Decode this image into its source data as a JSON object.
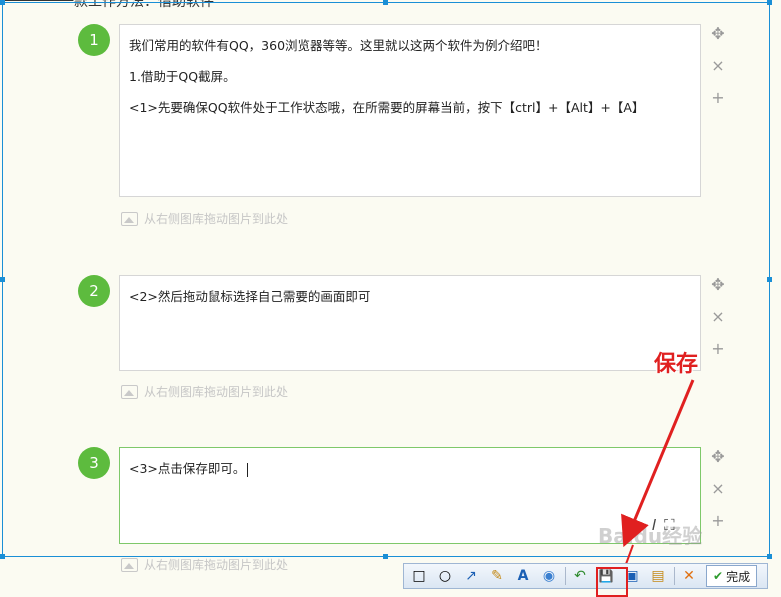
{
  "page": {
    "top_cut_text": "一款工作方法：借助软件"
  },
  "steps": [
    {
      "number": "1",
      "lines": [
        "我们常用的软件有QQ，360浏览器等等。这里就以这两个软件为例介绍吧！",
        "1.借助于QQ截屏。",
        "<1>先要确保QQ软件处于工作状态哦，在所需要的屏幕当前，按下【ctrl】+【Alt】+【A】"
      ],
      "image_hint": "从右侧图库拖动图片到此处"
    },
    {
      "number": "2",
      "lines": [
        "<2>然后拖动鼠标选择自己需要的画面即可"
      ],
      "image_hint": "从右侧图库拖动图片到此处"
    },
    {
      "number": "3",
      "lines": [
        "<3>点击保存即可。"
      ],
      "image_hint": "从右侧图库拖动图片到此处"
    }
  ],
  "side_controls": {
    "move": "✥",
    "delete": "×",
    "add": "+"
  },
  "annotation": {
    "label": "保存",
    "color": "#e02020"
  },
  "toolbar": {
    "buttons": [
      {
        "name": "rect-tool-icon",
        "glyph": "□"
      },
      {
        "name": "ellipse-tool-icon",
        "glyph": "○"
      },
      {
        "name": "arrow-tool-icon",
        "glyph": "↗"
      },
      {
        "name": "brush-tool-icon",
        "glyph": "✎"
      },
      {
        "name": "text-tool-icon",
        "glyph": "A"
      },
      {
        "name": "mosaic-tool-icon",
        "glyph": "◉"
      }
    ],
    "actions": [
      {
        "name": "undo-icon",
        "glyph": "↶"
      },
      {
        "name": "save-icon",
        "glyph": "💾"
      },
      {
        "name": "copy-to-screen-icon",
        "glyph": "▣"
      },
      {
        "name": "send-icon",
        "glyph": "▤"
      }
    ],
    "cancel_glyph": "✕",
    "done_label": "完成"
  },
  "watermark": "Baidu经验",
  "colors": {
    "accent_green": "#5dbb3e",
    "selection_blue": "#1a8fd6"
  }
}
